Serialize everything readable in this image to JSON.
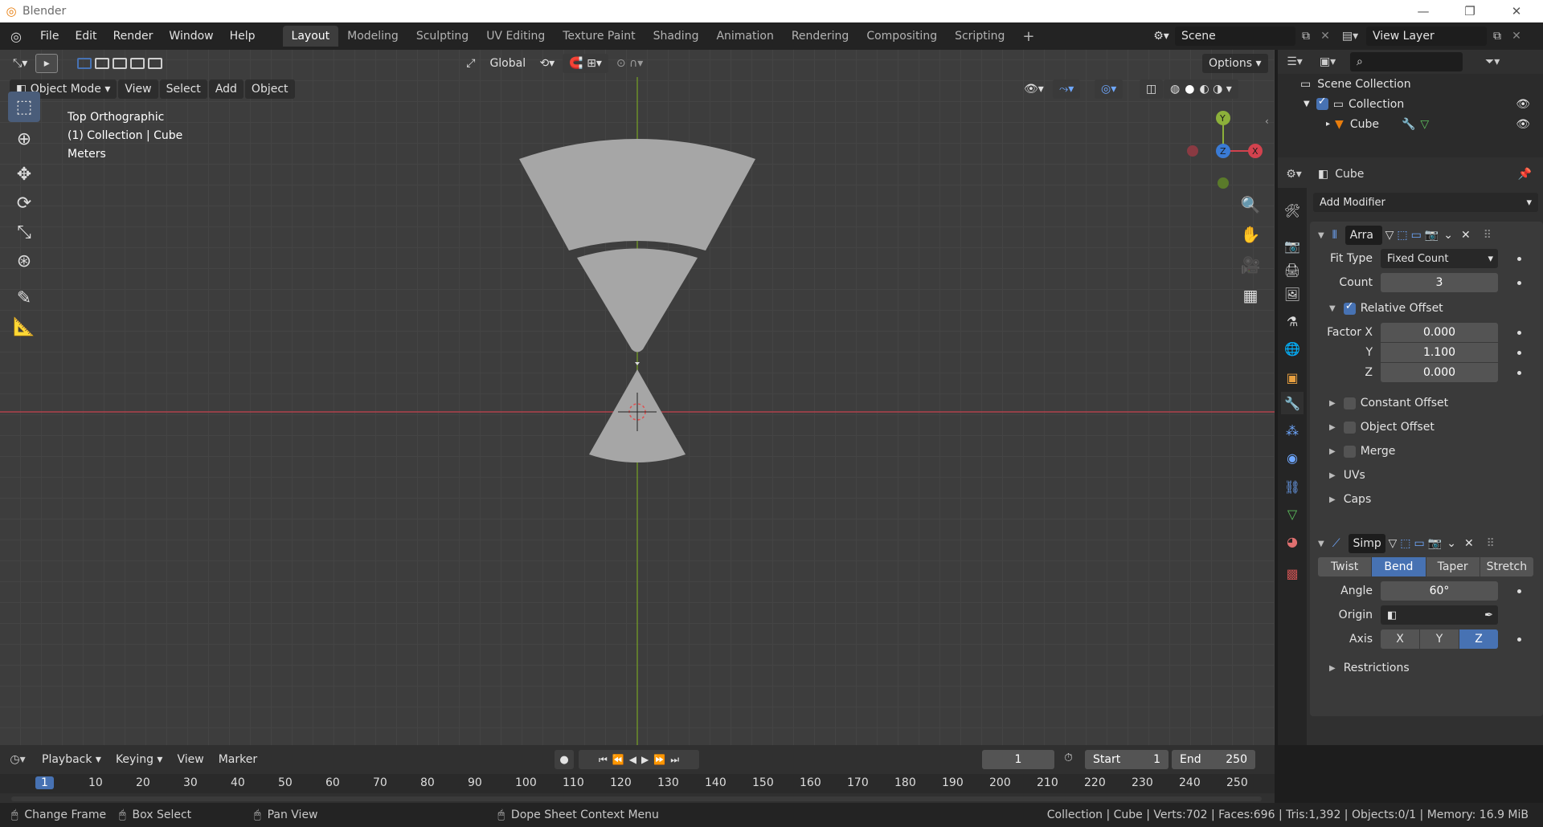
{
  "window": {
    "title": "Blender",
    "logo": "blender-icon"
  },
  "menus": [
    "File",
    "Edit",
    "Render",
    "Window",
    "Help"
  ],
  "workspace_tabs": [
    "Layout",
    "Modeling",
    "Sculpting",
    "UV Editing",
    "Texture Paint",
    "Shading",
    "Animation",
    "Rendering",
    "Compositing",
    "Scripting"
  ],
  "scene": {
    "name": "Scene",
    "view_layer": "View Layer"
  },
  "viewport": {
    "orientation": "Global",
    "options_label": "Options",
    "mode": "Object Mode",
    "menu": [
      "View",
      "Select",
      "Add",
      "Object"
    ],
    "overlay_lines": [
      "Top Orthographic",
      "(1) Collection | Cube",
      "Meters"
    ],
    "gizmo": {
      "x": "X",
      "y": "Y",
      "z": "Z"
    }
  },
  "outliner": {
    "scene_collection": "Scene Collection",
    "collection": "Collection",
    "object": "Cube"
  },
  "properties": {
    "object_name": "Cube",
    "add_modifier": "Add Modifier",
    "array": {
      "name": "Arra",
      "fit_type_label": "Fit Type",
      "fit_type": "Fixed Count",
      "count_label": "Count",
      "count": "3",
      "relative_offset": "Relative Offset",
      "factor_x_label": "Factor X",
      "factor_x": "0.000",
      "y_label": "Y",
      "y": "1.100",
      "z_label": "Z",
      "z": "0.000",
      "constant_offset": "Constant Offset",
      "object_offset": "Object Offset",
      "merge": "Merge",
      "uvs": "UVs",
      "caps": "Caps"
    },
    "simple_deform": {
      "name": "Simp",
      "modes": [
        "Twist",
        "Bend",
        "Taper",
        "Stretch"
      ],
      "active_mode": "Bend",
      "angle_label": "Angle",
      "angle": "60°",
      "origin_label": "Origin",
      "axis_label": "Axis",
      "axes": [
        "X",
        "Y",
        "Z"
      ],
      "active_axis": "Z",
      "restrictions": "Restrictions"
    }
  },
  "timeline": {
    "menus": [
      "Playback",
      "Keying",
      "View",
      "Marker"
    ],
    "current_frame": "1",
    "start_label": "Start",
    "start": "1",
    "end_label": "End",
    "end": "250",
    "ruler": [
      "1",
      "10",
      "20",
      "30",
      "40",
      "50",
      "60",
      "70",
      "80",
      "90",
      "100",
      "110",
      "120",
      "130",
      "140",
      "150",
      "160",
      "170",
      "180",
      "190",
      "200",
      "210",
      "220",
      "230",
      "240",
      "250"
    ]
  },
  "status": {
    "left": [
      "Change Frame",
      "Box Select",
      "Pan View",
      "Dope Sheet Context Menu"
    ],
    "right": "Collection | Cube | Verts:702 | Faces:696 | Tris:1,392 | Objects:0/1 | Memory: 16.9 MiB"
  }
}
